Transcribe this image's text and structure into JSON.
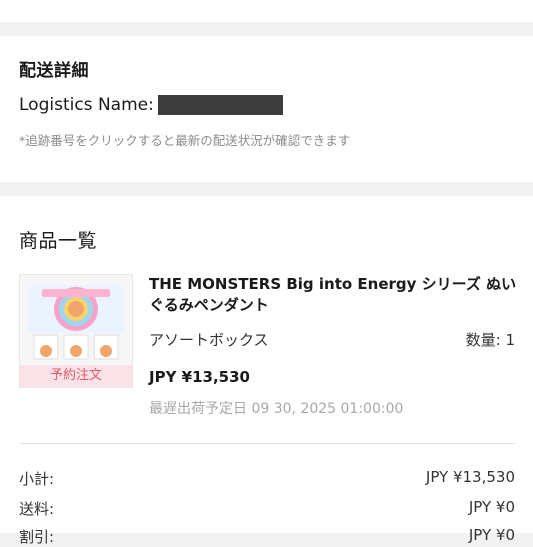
{
  "shipping": {
    "title": "配送詳細",
    "logistics_label": "Logistics Name:",
    "note": "*追跡番号をクリックすると最新の配送状況が確認できます"
  },
  "products": {
    "title": "商品一覧",
    "item": {
      "name": "THE MONSTERS Big into Energy シリーズ ぬいぐるみペンダント",
      "variant": "アソートボックス",
      "quantity": "数量: 1",
      "price": "JPY ¥13,530",
      "ship_date": "最遅出荷予定日 09 30, 2025 01:00:00",
      "badge": "予約注文"
    },
    "summary": [
      {
        "label": "小計:",
        "value": "JPY ¥13,530"
      },
      {
        "label": "送料:",
        "value": "JPY ¥0"
      },
      {
        "label": "割引:",
        "value": "JPY ¥0"
      }
    ]
  },
  "colors": {
    "badge_bg": "#fbe2e6",
    "badge_text": "#e05a6d",
    "redaction": "#3d3d3d"
  }
}
